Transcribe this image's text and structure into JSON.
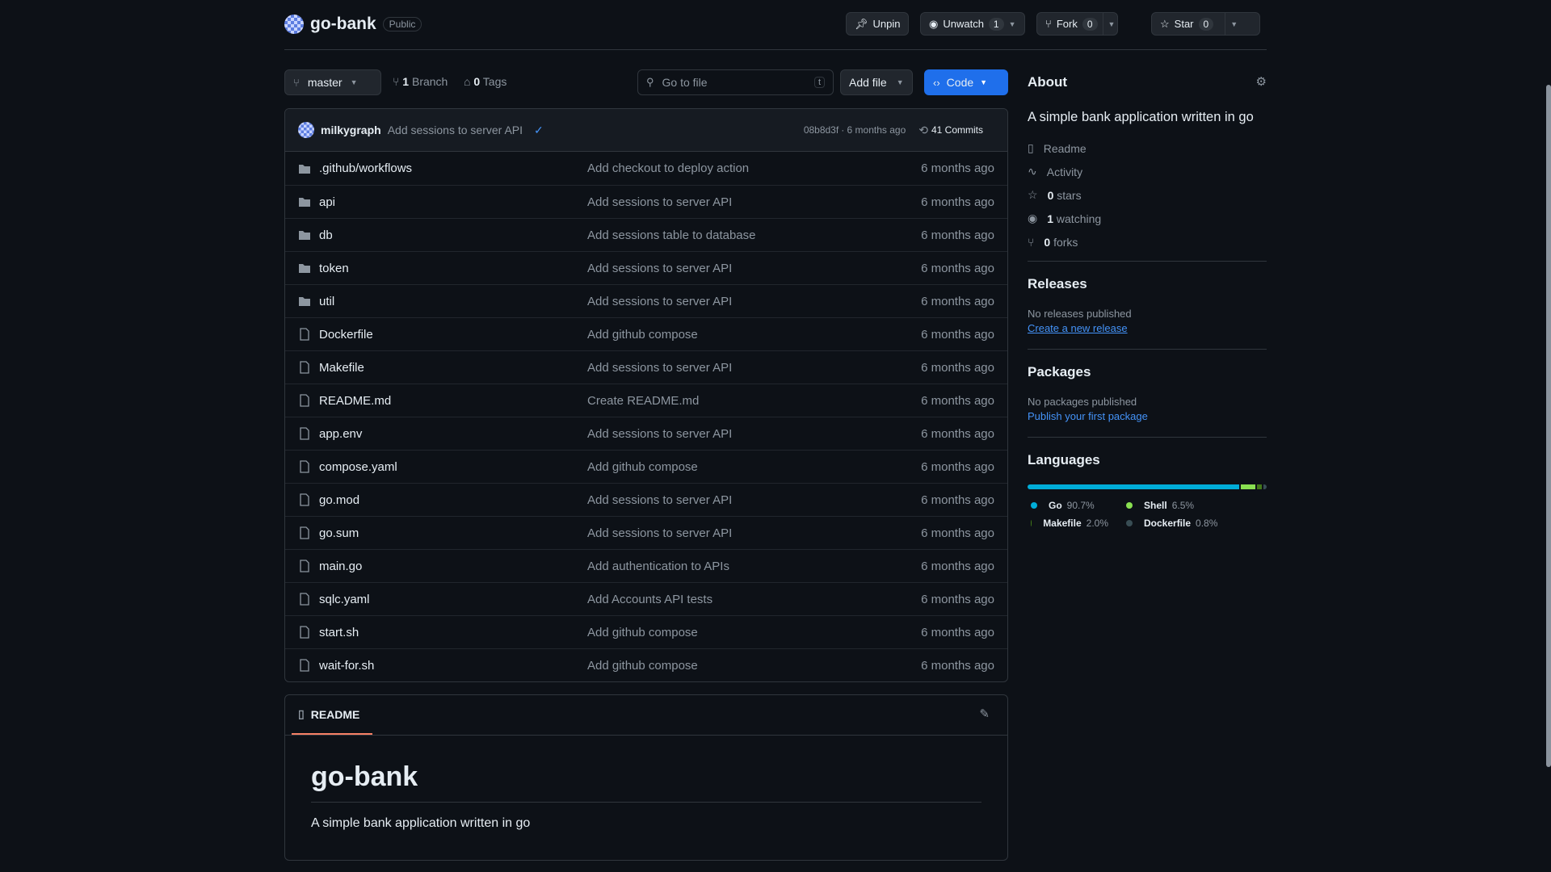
{
  "repo": {
    "name": "go-bank",
    "visibility": "Public"
  },
  "actions": {
    "unpin": "Unpin",
    "unwatch": "Unwatch",
    "watch_count": "1",
    "fork": "Fork",
    "fork_count": "0",
    "star": "Star",
    "star_count": "0"
  },
  "toolbar": {
    "branch": "master",
    "branch_count": "1",
    "branch_label": "Branch",
    "tag_count": "0",
    "tag_label": "Tags",
    "search_placeholder": "Go to file",
    "search_key": "t",
    "add_file": "Add file",
    "code": "Code"
  },
  "commit": {
    "author": "milkygraph",
    "message": "Add sessions to server API",
    "hash": "08b8d3f",
    "time": "· 6 months ago",
    "count": "41 Commits"
  },
  "files": [
    {
      "type": "dir",
      "name": ".github/workflows",
      "msg": "Add checkout to deploy action",
      "time": "6 months ago"
    },
    {
      "type": "dir",
      "name": "api",
      "msg": "Add sessions to server API",
      "time": "6 months ago"
    },
    {
      "type": "dir",
      "name": "db",
      "msg": "Add sessions table to database",
      "time": "6 months ago"
    },
    {
      "type": "dir",
      "name": "token",
      "msg": "Add sessions to server API",
      "time": "6 months ago"
    },
    {
      "type": "dir",
      "name": "util",
      "msg": "Add sessions to server API",
      "time": "6 months ago"
    },
    {
      "type": "file",
      "name": "Dockerfile",
      "msg": "Add github compose",
      "time": "6 months ago"
    },
    {
      "type": "file",
      "name": "Makefile",
      "msg": "Add sessions to server API",
      "time": "6 months ago"
    },
    {
      "type": "file",
      "name": "README.md",
      "msg": "Create README.md",
      "time": "6 months ago"
    },
    {
      "type": "file",
      "name": "app.env",
      "msg": "Add sessions to server API",
      "time": "6 months ago"
    },
    {
      "type": "file",
      "name": "compose.yaml",
      "msg": "Add github compose",
      "time": "6 months ago"
    },
    {
      "type": "file",
      "name": "go.mod",
      "msg": "Add sessions to server API",
      "time": "6 months ago"
    },
    {
      "type": "file",
      "name": "go.sum",
      "msg": "Add sessions to server API",
      "time": "6 months ago"
    },
    {
      "type": "file",
      "name": "main.go",
      "msg": "Add authentication to APIs",
      "time": "6 months ago"
    },
    {
      "type": "file",
      "name": "sqlc.yaml",
      "msg": "Add Accounts API tests",
      "time": "6 months ago"
    },
    {
      "type": "file",
      "name": "start.sh",
      "msg": "Add github compose",
      "time": "6 months ago"
    },
    {
      "type": "file",
      "name": "wait-for.sh",
      "msg": "Add github compose",
      "time": "6 months ago"
    }
  ],
  "readme": {
    "tab": "README",
    "title": "go-bank",
    "body": "A simple bank application written in go"
  },
  "about": {
    "heading": "About",
    "description": "A simple bank application written in go",
    "readme": "Readme",
    "activity": "Activity",
    "stars_n": "0",
    "stars": "stars",
    "watching_n": "1",
    "watching": "watching",
    "forks_n": "0",
    "forks": "forks"
  },
  "releases": {
    "heading": "Releases",
    "none": "No releases published",
    "link": "Create a new release"
  },
  "packages": {
    "heading": "Packages",
    "none": "No packages published",
    "link": "Publish your first package"
  },
  "languages": {
    "heading": "Languages",
    "items": [
      {
        "name": "Go",
        "pct": "90.7%",
        "value": 90.7,
        "color": "#00add8"
      },
      {
        "name": "Shell",
        "pct": "6.5%",
        "value": 6.5,
        "color": "#89e051"
      },
      {
        "name": "Makefile",
        "pct": "2.0%",
        "value": 2.0,
        "color": "#427819"
      },
      {
        "name": "Dockerfile",
        "pct": "0.8%",
        "value": 0.8,
        "color": "#384d54"
      }
    ]
  }
}
